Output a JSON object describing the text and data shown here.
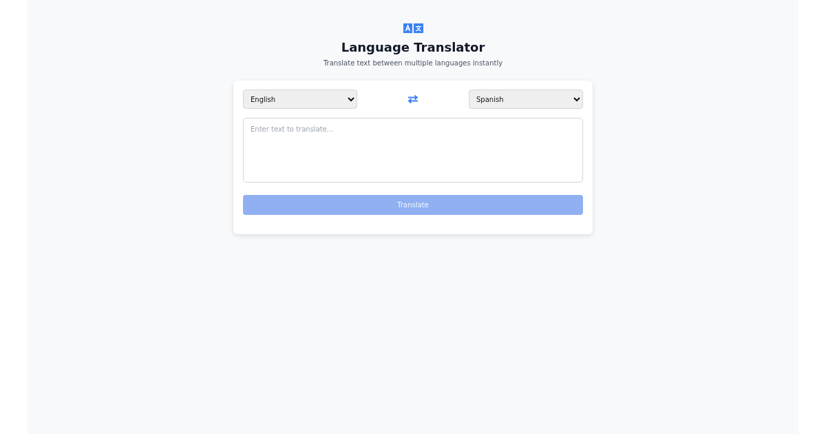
{
  "header": {
    "title": "Language Translator",
    "subtitle": "Translate text between multiple languages instantly"
  },
  "source_language": {
    "value": "English"
  },
  "target_language": {
    "value": "Spanish"
  },
  "input": {
    "placeholder": "Enter text to translate..."
  },
  "translate_button": {
    "label": "Translate",
    "disabled": true
  }
}
